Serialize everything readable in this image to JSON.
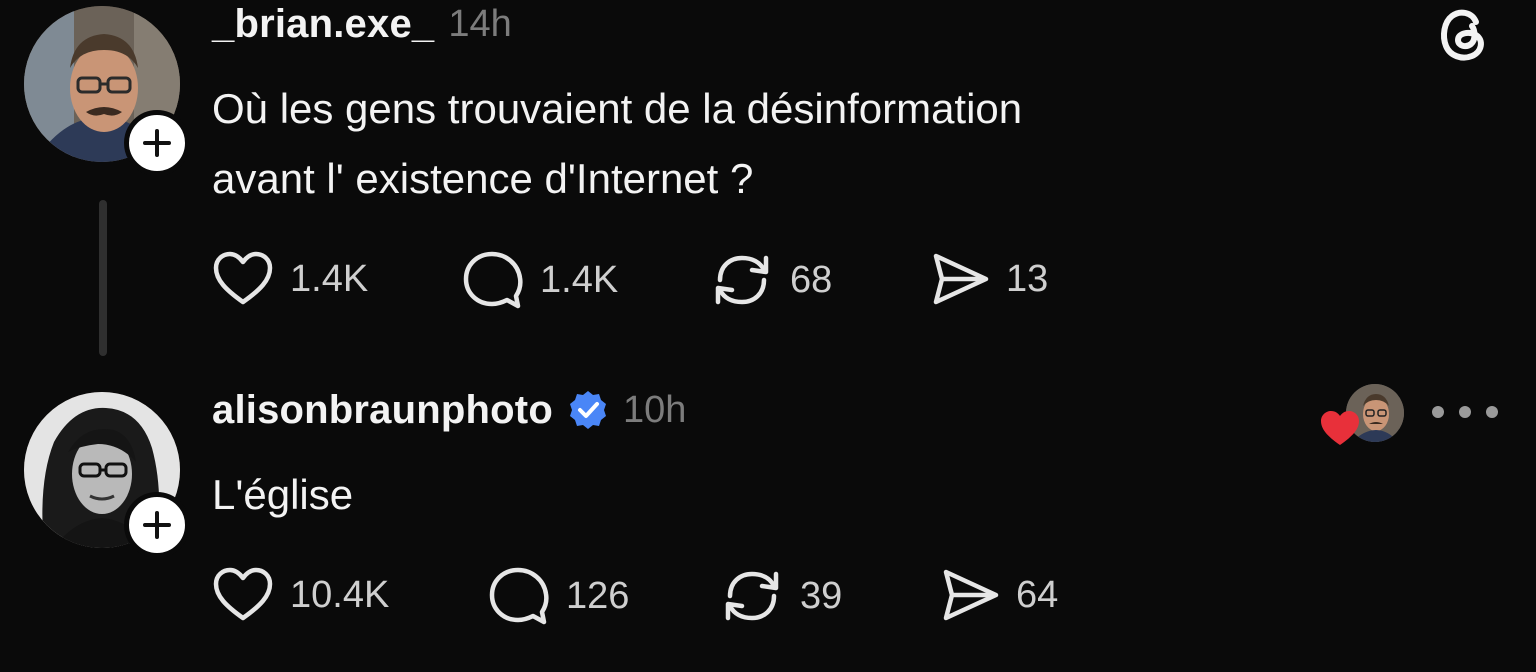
{
  "post": {
    "username": "_brian.exe_",
    "time": "14h",
    "text_lines": [
      "Où les gens trouvaient de la désinformation",
      "avant l' existence d'Internet ?"
    ],
    "likes": "1.4K",
    "replies": "1.4K",
    "reposts": "68",
    "shares": "13"
  },
  "reply": {
    "username": "alisonbraunphoto",
    "verified": true,
    "time": "10h",
    "text": "L'église",
    "likes": "10.4K",
    "replies": "126",
    "reposts": "39",
    "shares": "64",
    "liked_by_author": true
  },
  "icons": {
    "logo": "threads-logo-icon",
    "follow": "plus-icon",
    "like": "heart-outline-icon",
    "reply": "speech-bubble-icon",
    "repost": "repost-arrows-icon",
    "share": "send-icon",
    "verified": "verified-badge-icon",
    "more": "more-horizontal-icon"
  },
  "colors": {
    "background": "#0a0a0a",
    "text": "#f3f3f3",
    "muted": "#7c7c7c",
    "verified": "#4a86f7",
    "liked_heart": "#e8303a"
  }
}
